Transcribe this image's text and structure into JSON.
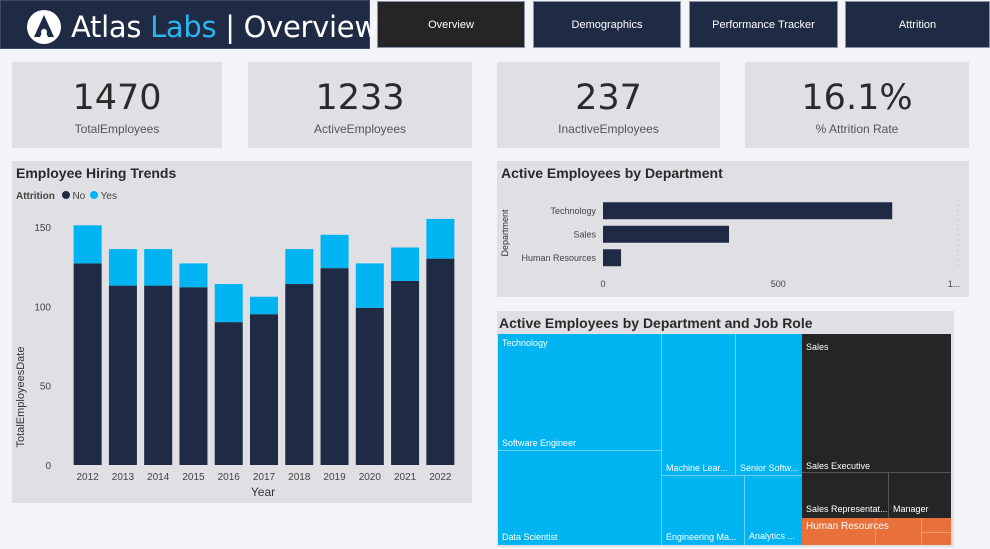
{
  "header": {
    "title_main": "Atlas ",
    "title_accent": "Labs",
    "title_rest": " | Overview",
    "nav": [
      {
        "label": "Overview",
        "active": true
      },
      {
        "label": "Demographics",
        "active": false
      },
      {
        "label": "Performance Tracker",
        "active": false
      },
      {
        "label": "Attrition",
        "active": false
      }
    ]
  },
  "kpis": [
    {
      "value": "1470",
      "label": "TotalEmployees"
    },
    {
      "value": "1233",
      "label": "ActiveEmployees"
    },
    {
      "value": "237",
      "label": "InactiveEmployees"
    },
    {
      "value": "16.1%",
      "label": "% Attrition Rate"
    }
  ],
  "hiring": {
    "title": "Employee Hiring Trends",
    "legend_title": "Attrition",
    "legend_no": "No",
    "legend_yes": "Yes",
    "ylabel": "TotalEmployeesDate",
    "xlabel": "Year"
  },
  "dept": {
    "title": "Active Employees by Department",
    "ylabel": "Department"
  },
  "treemap": {
    "title": "Active Employees by Department and Job Role",
    "cells": [
      {
        "label": "Technology",
        "color": "#00b4f1"
      },
      {
        "label": "Software Engineer",
        "color": "#00b4f1"
      },
      {
        "label": "Data Scientist",
        "color": "#00b4f1"
      },
      {
        "label": "Machine Lear...",
        "color": "#00b4f1"
      },
      {
        "label": "Senior Softw...",
        "color": "#00b4f1"
      },
      {
        "label": "Engineering Ma...",
        "color": "#00b4f1"
      },
      {
        "label": "Analytics ...",
        "color": "#00b4f1"
      },
      {
        "label": "Sales",
        "color": "#252427"
      },
      {
        "label": "Sales Executive",
        "color": "#252427"
      },
      {
        "label": "Sales Representat...",
        "color": "#252427"
      },
      {
        "label": "Manager",
        "color": "#252427"
      },
      {
        "label": "Human Resources",
        "color": "#e8703a"
      }
    ]
  },
  "chart_data": [
    {
      "type": "bar",
      "stacked": true,
      "title": "Employee Hiring Trends",
      "xlabel": "Year",
      "ylabel": "TotalEmployeesDate",
      "categories": [
        "2012",
        "2013",
        "2014",
        "2015",
        "2016",
        "2017",
        "2018",
        "2019",
        "2020",
        "2021",
        "2022"
      ],
      "series": [
        {
          "name": "No",
          "color": "#1f2a44",
          "values": [
            127,
            113,
            113,
            112,
            90,
            95,
            114,
            124,
            99,
            116,
            130
          ]
        },
        {
          "name": "Yes",
          "color": "#00b4f1",
          "values": [
            24,
            23,
            23,
            15,
            24,
            11,
            22,
            21,
            28,
            21,
            25
          ]
        }
      ],
      "yticks": [
        0,
        50,
        100,
        150
      ],
      "ylim": [
        0,
        160
      ],
      "legend": "top-left",
      "grid": false
    },
    {
      "type": "bar",
      "orientation": "horizontal",
      "title": "Active Employees by Department",
      "ylabel": "Department",
      "categories": [
        "Technology",
        "Sales",
        "Human Resources"
      ],
      "values": [
        817,
        356,
        51
      ],
      "color": "#1f2a44",
      "xticks": [
        "0",
        "500",
        "1..."
      ],
      "xlim": [
        0,
        1000
      ],
      "grid": true
    }
  ]
}
